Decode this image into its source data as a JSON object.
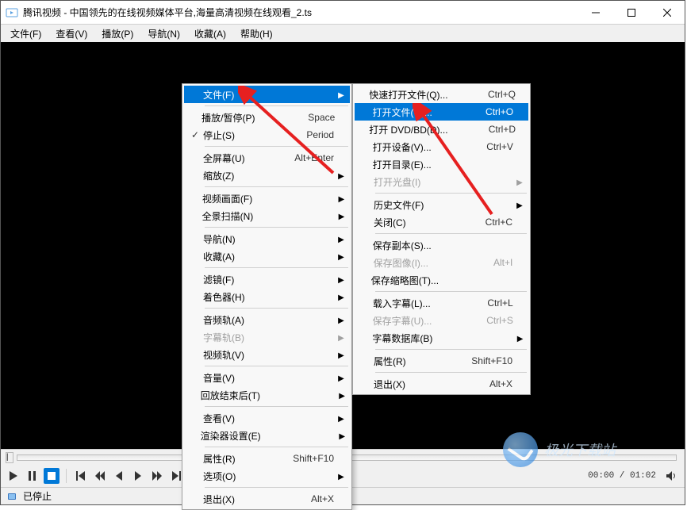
{
  "window": {
    "title": "腾讯视频 - 中国领先的在线视频媒体平台,海量高清视频在线观看_2.ts"
  },
  "menubar": {
    "file": "文件(F)",
    "view": "查看(V)",
    "play": "播放(P)",
    "nav": "导航(N)",
    "fav": "收藏(A)",
    "help": "帮助(H)"
  },
  "status": {
    "text": "已停止"
  },
  "time": {
    "display": "00:00 / 01:02"
  },
  "watermark": {
    "text": "极光下载站"
  },
  "ctx1": {
    "file": "文件(F)",
    "playpause": "播放/暂停(P)",
    "playpause_sc": "Space",
    "stop": "停止(S)",
    "stop_sc": "Period",
    "fullscreen": "全屏幕(U)",
    "fullscreen_sc": "Alt+Enter",
    "zoom": "缩放(Z)",
    "videoframe": "视频画面(F)",
    "panscan": "全景扫描(N)",
    "nav": "导航(N)",
    "fav": "收藏(A)",
    "filter": "滤镜(F)",
    "shader": "着色器(H)",
    "audiotrack": "音频轨(A)",
    "subtrack": "字幕轨(B)",
    "videotrack": "视频轨(V)",
    "volume": "音量(V)",
    "afterplay": "回放结束后(T)",
    "view": "查看(V)",
    "renderer": "渲染器设置(E)",
    "properties": "属性(R)",
    "properties_sc": "Shift+F10",
    "options": "选项(O)",
    "exit": "退出(X)",
    "exit_sc": "Alt+X"
  },
  "ctx2": {
    "quickopen": "快速打开文件(Q)...",
    "quickopen_sc": "Ctrl+Q",
    "openfile": "打开文件(O)...",
    "openfile_sc": "Ctrl+O",
    "opendvd": "打开 DVD/BD(D)...",
    "opendvd_sc": "Ctrl+D",
    "opendevice": "打开设备(V)...",
    "opendevice_sc": "Ctrl+V",
    "opendir": "打开目录(E)...",
    "opendisc": "打开光盘(I)",
    "history": "历史文件(F)",
    "close": "关闭(C)",
    "close_sc": "Ctrl+C",
    "savecopy": "保存副本(S)...",
    "saveimg": "保存图像(I)...",
    "saveimg_sc": "Alt+I",
    "savethumb": "保存缩略图(T)...",
    "loadsub": "载入字幕(L)...",
    "loadsub_sc": "Ctrl+L",
    "savesub": "保存字幕(U)...",
    "savesub_sc": "Ctrl+S",
    "subdb": "字幕数据库(B)",
    "properties": "属性(R)",
    "properties_sc": "Shift+F10",
    "exit": "退出(X)",
    "exit_sc": "Alt+X"
  }
}
